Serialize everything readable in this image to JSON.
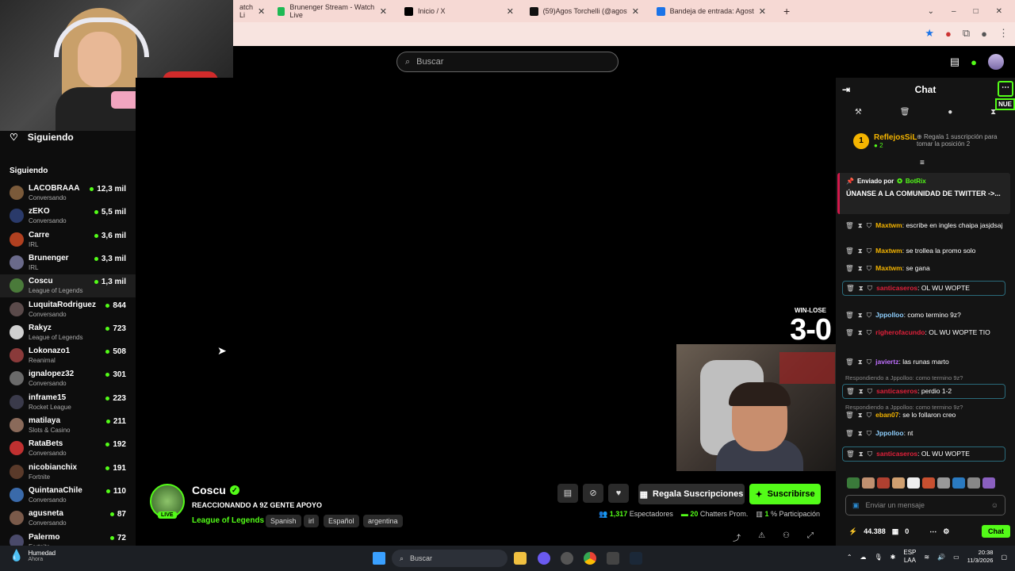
{
  "browser": {
    "tabs": [
      {
        "label": "atch Li",
        "icon_color": "#53fc18"
      },
      {
        "label": "Brunenger Stream - Watch Live",
        "icon_color": "#1db954"
      },
      {
        "label": "Inicio / X",
        "icon_color": "#000000"
      },
      {
        "label": "(59)Agos Torchelli (@agostorch",
        "icon_color": "#111111"
      },
      {
        "label": "Bandeja de entrada: Agostina T",
        "icon_color": "#1a73e8"
      }
    ],
    "new_tab": "+",
    "window_controls": [
      "⌄",
      "–",
      "□",
      "✕"
    ]
  },
  "site": {
    "search_placeholder": "Buscar"
  },
  "sidebar": {
    "header": "Siguiendo",
    "section": "Siguiendo",
    "channels": [
      {
        "name": "LACOBRAAA",
        "category": "Conversando",
        "viewers": "12,3 mil",
        "color": "#7a5a3a"
      },
      {
        "name": "zEKO",
        "category": "Conversando",
        "viewers": "5,5 mil",
        "color": "#2a3a6a"
      },
      {
        "name": "Carre",
        "category": "IRL",
        "viewers": "3,6 mil",
        "color": "#b04020"
      },
      {
        "name": "Brunenger",
        "category": "IRL",
        "viewers": "3,3 mil",
        "color": "#6a6a8a"
      },
      {
        "name": "Coscu",
        "category": "League of Legends",
        "viewers": "1,3 mil",
        "color": "#4a7a3a",
        "active": true
      },
      {
        "name": "LuquitaRodriguez",
        "category": "Conversando",
        "viewers": "844",
        "color": "#5a4a4a"
      },
      {
        "name": "Rakyz",
        "category": "League of Legends",
        "viewers": "723",
        "color": "#d0d0d0"
      },
      {
        "name": "Lokonazo1",
        "category": "Reanimal",
        "viewers": "508",
        "color": "#8a3a3a"
      },
      {
        "name": "ignalopez32",
        "category": "Conversando",
        "viewers": "301",
        "color": "#6a6a6a"
      },
      {
        "name": "inframe15",
        "category": "Rocket League",
        "viewers": "223",
        "color": "#3a3a4a"
      },
      {
        "name": "matilaya",
        "category": "Slots & Casino",
        "viewers": "211",
        "color": "#8a6a5a"
      },
      {
        "name": "RataBets",
        "category": "Conversando",
        "viewers": "192",
        "color": "#c03030"
      },
      {
        "name": "nicobianchix",
        "category": "Fortnite",
        "viewers": "191",
        "color": "#5a3a2a"
      },
      {
        "name": "QuintanaChile",
        "category": "Conversando",
        "viewers": "110",
        "color": "#3a6aaa"
      },
      {
        "name": "agusneta",
        "category": "Conversando",
        "viewers": "87",
        "color": "#7a5a4a"
      },
      {
        "name": "Palermo",
        "category": "Fortnite",
        "viewers": "72",
        "color": "#4a4a6a"
      }
    ]
  },
  "video": {
    "score_label": "WIN-LOSE",
    "score": "3-0"
  },
  "stream": {
    "channel": "Coscu",
    "live": "LIVE",
    "title": "REACCIONANDO A 9Z GENTE APOYO",
    "category": "League of Legends",
    "tags": [
      "Spanish",
      "irl",
      "Español",
      "argentina"
    ],
    "gift_label": "Regala Suscripciones",
    "subscribe_label": "Suscribirse",
    "viewers": "1,317",
    "viewers_label": "Espectadores",
    "chatters": "20",
    "chatters_label": "Chatters Prom.",
    "participation": "1",
    "participation_label": "% Participación"
  },
  "chat": {
    "title": "Chat",
    "nue": "NUE",
    "top_gifter": {
      "rank": "1",
      "name": "ReflejosSiL",
      "count": "2"
    },
    "gift_goal": "Regala 1 suscripción para tomar la posición 2",
    "pinned_by": "Enviado por",
    "pinned_bot": "BotRix",
    "pinned_msg": "ÚNANSE A LA COMUNIDAD DE TWITTER ->...",
    "messages": [
      {
        "user": "Maxtwm",
        "color": "#f4b400",
        "text": "escribe en ingles chaipa jasjdsaj"
      },
      {
        "user": "Maxtwm",
        "color": "#f4b400",
        "text": "se trollea la promo solo"
      },
      {
        "user": "Maxtwm",
        "color": "#f4b400",
        "text": "se gana"
      },
      {
        "user": "santicaseros",
        "color": "#e0203a",
        "text": "OL WU WOPTE"
      },
      {
        "user": "Jppolloo",
        "color": "#8fd0ff",
        "text": "como termino 9z?"
      },
      {
        "user": "righerofacundo",
        "color": "#e0203a",
        "text": "OL WU WOPTE TIO"
      },
      {
        "user": "javiertz",
        "color": "#c070ff",
        "text": "las runas marto"
      },
      {
        "user": "santicaseros",
        "color": "#e0203a",
        "text": "perdio 1-2"
      },
      {
        "user": "eban07",
        "color": "#f4b400",
        "text": "se lo follaron creo"
      },
      {
        "user": "Jppolloo",
        "color": "#8fd0ff",
        "text": "nt"
      },
      {
        "user": "santicaseros",
        "color": "#e0203a",
        "text": "OL WU WOPTE"
      }
    ],
    "reply_1": "Respondiendo a Jppolloo: como termino 9z?",
    "reply_2": "Respondiendo a Jppolloo: como termino 9z?",
    "input_placeholder": "Enviar un mensaje",
    "points": "44.388",
    "zero": "0",
    "send_label": "Chat"
  },
  "taskbar": {
    "weather_title": "Humedad",
    "weather_sub": "Ahora",
    "search_placeholder": "Buscar",
    "lang": "ESP",
    "lang2": "LAA",
    "time": "20:38",
    "date": "11/3/2026"
  }
}
